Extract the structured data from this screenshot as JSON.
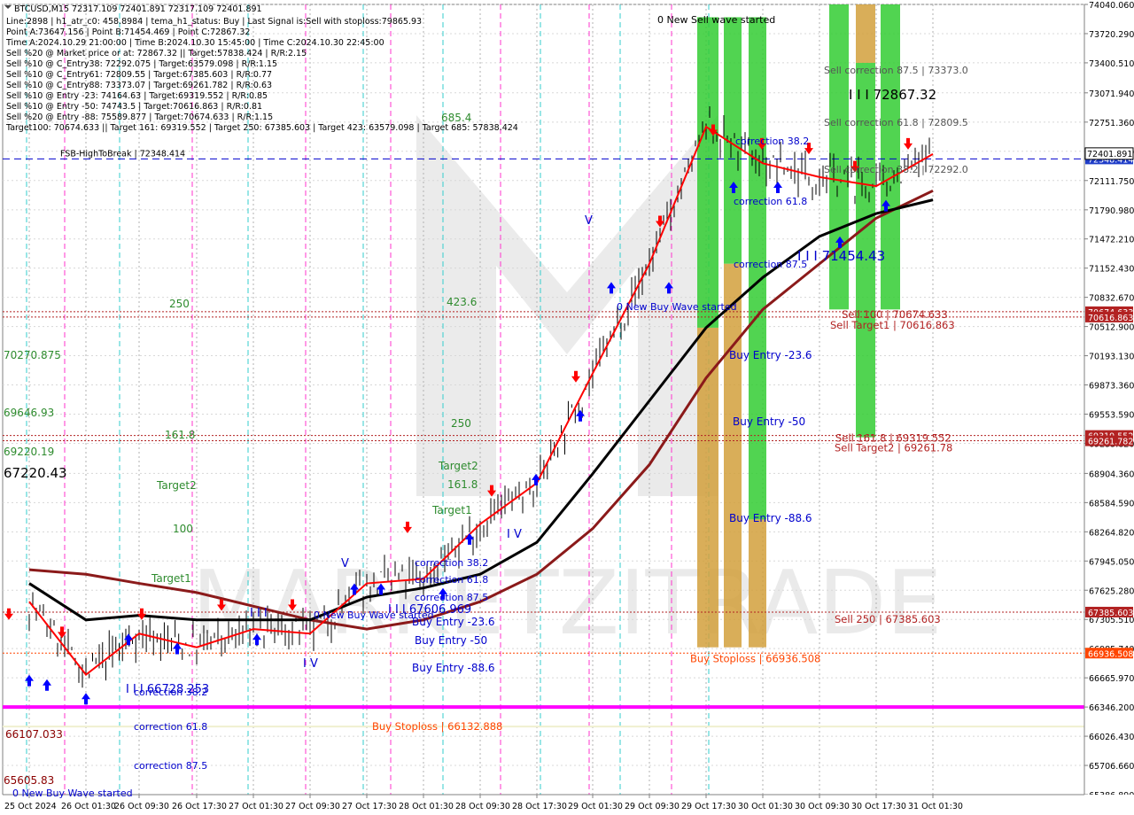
{
  "header": {
    "symbol_line": "BTCUSD,M15  72317.109 72401.891 72317.109 72401.891",
    "info_lines": [
      "Line:2898 | h1_atr_c0: 458.8984 | tema_h1_status: Buy | Last Signal is:Sell with stoploss:79865.93",
      "Point A:73647.156 | Point B:71454.469 | Point C:72867.32",
      "Time A:2024.10.29 21:00:00 | Time B:2024.10.30 15:45:00 | Time C:2024.10.30 22:45:00",
      "Sell %20 @ Market price or at: 72867.32 || Target:57838.424 | R/R:2.15",
      "Sell %10 @ C_Entry38: 72292.075 | Target:63579.098 | R/R:1.15",
      "Sell %10 @ C_Entry61: 72809.55 | Target:67385.603 | R/R:0.77",
      "Sell %10 @ C_Entry88: 73373.07 | Target:69261.782 | R/R:0.63",
      "Sell %10 @ Entry -23: 74164.63 | Target:69319.552 | R/R:0.85",
      "Sell %10 @ Entry -50: 74743.5 | Target:70616.863 | R/R:0.81",
      "Sell %20 @ Entry -88: 75589.877 | Target:70674.633 | R/R:1.15",
      "Target100: 70674.633 || Target 161: 69319.552 | Target 250: 67385.603 | Target 423: 63579.098 | Target 685: 57838.424"
    ]
  },
  "colors": {
    "grid": "#c0c0c0",
    "bull": "#000000",
    "ema_red": "#ff0000",
    "ma_black": "#000000",
    "ma_brown": "#8b1a1a",
    "magenta": "#ff00ff",
    "blue_dash": "#0000cd",
    "green_band": "#32cd32",
    "orange_band": "#d2a03c",
    "buy_arrow": "#0000ff",
    "sell_arrow": "#ff0000"
  },
  "chart_data": {
    "type": "line",
    "title": "BTCUSD,M15",
    "ylim": [
      65386.89,
      74040.06
    ],
    "y_ticks": [
      74040.06,
      73720.29,
      73400.51,
      73071.94,
      72751.36,
      72431.59,
      72111.75,
      71790.98,
      71472.21,
      71152.43,
      70832.67,
      70512.9,
      70193.13,
      69873.36,
      69553.59,
      69233.82,
      68904.36,
      68584.59,
      68264.82,
      67945.05,
      67625.28,
      67305.51,
      66985.74,
      66665.97,
      66346.2,
      66026.43,
      65706.66,
      65386.89
    ],
    "y_tick_labels": [
      "74040.060",
      "73720.290",
      "73400.510",
      "73071.940",
      "72751.360",
      "72431.590",
      "72111.750",
      "71790.980",
      "71472.210",
      "71152.430",
      "70832.670",
      "70512.900",
      "70193.130",
      "69873.360",
      "69553.590",
      "69233.820",
      "68904.360",
      "68584.590",
      "68264.820",
      "67945.050",
      "67625.280",
      "67305.510",
      "66985.740",
      "66665.970",
      "66346.200",
      "66026.430",
      "65706.660",
      "65386.890"
    ],
    "x_labels": [
      "25 Oct 2024",
      "26 Oct 01:30",
      "26 Oct 09:30",
      "26 Oct 17:30",
      "27 Oct 01:30",
      "27 Oct 09:30",
      "27 Oct 17:30",
      "28 Oct 01:30",
      "28 Oct 09:30",
      "28 Oct 17:30",
      "29 Oct 01:30",
      "29 Oct 09:30",
      "29 Oct 17:30",
      "30 Oct 01:30",
      "30 Oct 09:30",
      "30 Oct 17:30",
      "31 Oct 01:30"
    ],
    "price_series": {
      "name": "",
      "x": [
        "25 Oct 2024",
        "26 Oct 01:30",
        "26 Oct 09:30",
        "26 Oct 17:30",
        "27 Oct 01:30",
        "27 Oct 09:30",
        "27 Oct 17:30",
        "28 Oct 01:30",
        "28 Oct 09:30",
        "28 Oct 17:30",
        "29 Oct 01:30",
        "29 Oct 09:30",
        "29 Oct 17:30",
        "30 Oct 01:30",
        "30 Oct 09:30",
        "30 Oct 17:30",
        "31 Oct 01:30"
      ],
      "values": [
        67500,
        66700,
        67150,
        67000,
        67200,
        67150,
        67700,
        67750,
        68350,
        68800,
        70000,
        71200,
        72700,
        72300,
        72150,
        72050,
        72401.891
      ]
    },
    "series": [
      {
        "name": "",
        "values": [
          67700,
          67300,
          67350,
          67300,
          67300,
          67300,
          67550,
          67650,
          67800,
          68150,
          68900,
          69700,
          70500,
          71050,
          71500,
          71750,
          71900
        ]
      },
      {
        "name": "",
        "values": [
          67850,
          67800,
          67700,
          67600,
          67450,
          67300,
          67200,
          67300,
          67500,
          67800,
          68300,
          69000,
          69950,
          70700,
          71200,
          71700,
          72000
        ]
      }
    ],
    "horizontal_levels": [
      {
        "label": "FSB-HighToBreak | 72348.414",
        "value": 72348.414,
        "color": "#0000cd",
        "style": "dash",
        "price_tag": "72348.414"
      },
      {
        "label": "Sell 100 | 70674.633",
        "value": 70674.633,
        "color": "#b22222",
        "style": "dot",
        "price_tag": "70674.633"
      },
      {
        "label": "Sell Target1 | 70616.863",
        "value": 70616.863,
        "color": "#b22222",
        "style": "dot",
        "price_tag": "70616.863"
      },
      {
        "label": "Sell 161.8 | 69319.552",
        "value": 69319.552,
        "color": "#b22222",
        "style": "dot",
        "price_tag": "69319.552"
      },
      {
        "label": "Sell Target2 | 69261.78",
        "value": 69261.78,
        "color": "#b22222",
        "style": "dot",
        "price_tag": "69261.782"
      },
      {
        "label": "Sell 250 | 67385.603",
        "value": 67385.603,
        "color": "#b22222",
        "style": "dot",
        "price_tag": "67385.603"
      },
      {
        "label": "Buy Stoploss | 66936.508",
        "value": 66936.508,
        "color": "#ff4500",
        "style": "dot",
        "price_tag": "66936.508"
      },
      {
        "label": "",
        "value": 66346.2,
        "color": "#ff00ff",
        "style": "solid",
        "price_tag": ""
      },
      {
        "label": "Buy Stoploss | 66132.888",
        "value": 66132.888,
        "color": "#f0f0d0",
        "style": "solid",
        "price_tag": ""
      }
    ],
    "annotations": [
      "0 New Sell wave started",
      "0 New Buy Wave started",
      "0 New Buy Wave started",
      "0 New Buy Wave started",
      "Sell correction 87.5 | 73373.0",
      "I I I 72867.32",
      "Sell correction 61.8 | 72809.5",
      "Sell correction 38.2 | 72292.0",
      "correction 38.2",
      "correction 61.8",
      "correction 87.5",
      "I I I 71454.43",
      "I I I 67606.969",
      "I I I 66728.253",
      "Buy Entry -23.6",
      "Buy Entry -50",
      "Buy Entry -88.6",
      "685.4",
      "423.6",
      "250",
      "161.8",
      "Target2",
      "Target1",
      "100",
      "70270.875",
      "69646.93",
      "69220.19",
      "67220.43",
      "66107.033",
      "65605.83",
      "V",
      "V",
      "I V",
      "I V",
      "I I I"
    ],
    "current_price": "72401.891",
    "grid": true
  }
}
